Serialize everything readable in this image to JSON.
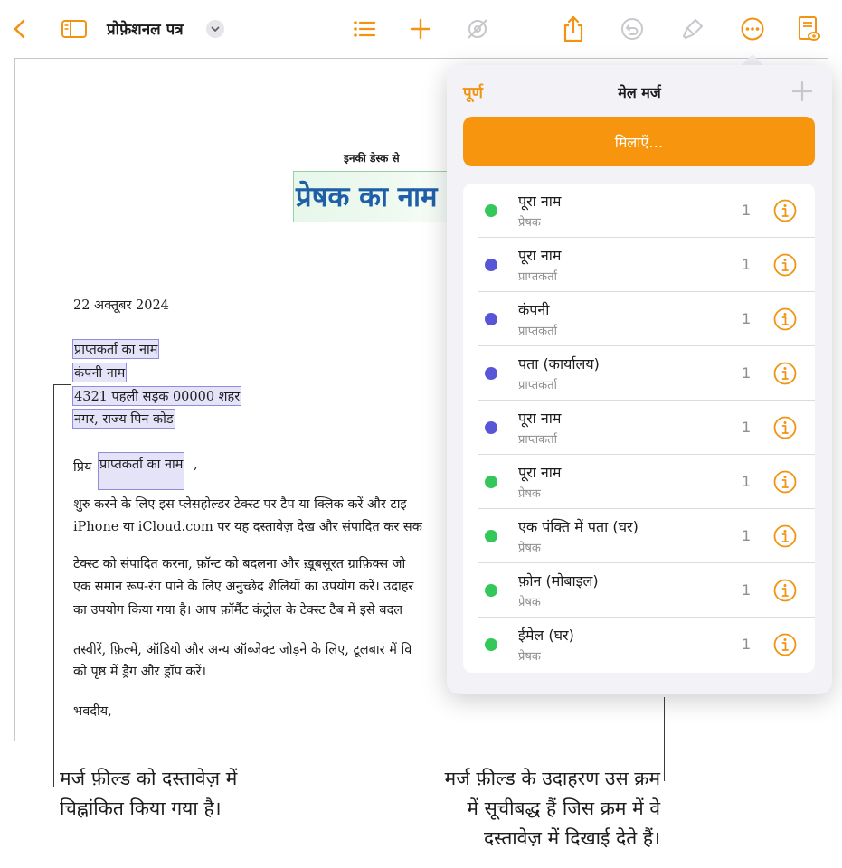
{
  "toolbar": {
    "document_title": "प्रोफ़ेशनल पत्र",
    "icons": [
      "back-chevron-icon",
      "sidebar-icon",
      "title-dropdown-icon",
      "list-icon",
      "add-icon",
      "collaborate-icon",
      "share-icon",
      "undo-icon",
      "format-brush-icon",
      "more-icon",
      "reading-view-icon"
    ],
    "accent": "#f29311"
  },
  "document": {
    "header_small": "इनकी डेस्क से",
    "sender_name_field": "प्रेषक का नाम",
    "date": "22 अक्तूबर 2024",
    "address": {
      "recipient_name": "प्राप्तकर्ता का नाम",
      "company": "कंपनी नाम",
      "street": "4321 पहली सड़क 00000 शहर",
      "city_state": "नगर, राज्य पिन कोड"
    },
    "salutation_prefix": "प्रिय",
    "salutation_field": "प्राप्तकर्ता का नाम",
    "salutation_suffix": ",",
    "paragraphs": [
      "शुरु करने के लिए इस प्लेसहोल्डर टेक्स्ट पर टैप या क्लिक करें और टाइ",
      "iPhone या iCloud.com पर यह दस्तावेज़ देख और संपादित कर सक",
      "टेक्स्ट को संपादित करना, फ़ॉन्ट को बदलना और ख़ूबसूरत ग्राफ़िक्स जो",
      "एक समान रूप-रंग पाने के लिए अनुच्छेद शैलियों का उपयोग करें। उदाहर",
      "का उपयोग किया गया है। आप फ़ॉर्मैट कंट्रोल के टेक्स्ट टैब में इसे बदल",
      "तस्वीरें, फ़िल्में, ऑडियो और अन्य ऑब्जेक्ट जोड़ने के लिए, टूलबार में वि",
      "को पृष्ठ में ड्रैग और ड्रॉप करें।"
    ],
    "closing": "भवदीय,",
    "field_colors": {
      "sender": "#9ad0a7",
      "recipient": "#8f8cdb"
    }
  },
  "popover": {
    "done_label": "पूर्ण",
    "title": "मेल मर्ज",
    "merge_button": "मिलाएँ…",
    "colors": {
      "sender": "#34c759",
      "recipient": "#5856d6",
      "button": "#f7950e"
    },
    "fields": [
      {
        "title": "पूरा नाम",
        "subtitle": "प्रेषक",
        "group": "sender",
        "count": "1"
      },
      {
        "title": "पूरा नाम",
        "subtitle": "प्राप्तकर्ता",
        "group": "recipient",
        "count": "1"
      },
      {
        "title": "कंपनी",
        "subtitle": "प्राप्तकर्ता",
        "group": "recipient",
        "count": "1"
      },
      {
        "title": "पता (कार्यालय)",
        "subtitle": "प्राप्तकर्ता",
        "group": "recipient",
        "count": "1"
      },
      {
        "title": "पूरा नाम",
        "subtitle": "प्राप्तकर्ता",
        "group": "recipient",
        "count": "1"
      },
      {
        "title": "पूरा नाम",
        "subtitle": "प्रेषक",
        "group": "sender",
        "count": "1"
      },
      {
        "title": "एक पंक्ति में पता (घर)",
        "subtitle": "प्रेषक",
        "group": "sender",
        "count": "1"
      },
      {
        "title": "फ़ोन (मोबाइल)",
        "subtitle": "प्रेषक",
        "group": "sender",
        "count": "1"
      },
      {
        "title": "ईमेल (घर)",
        "subtitle": "प्रेषक",
        "group": "sender",
        "count": "1"
      }
    ]
  },
  "callouts": {
    "left": [
      "मर्ज फ़ील्ड को दस्तावेज़ में",
      "चिह्नांकित किया गया है।"
    ],
    "right": [
      "मर्ज फ़ील्ड के उदाहरण उस क्रम",
      "में सूचीबद्ध हैं जिस क्रम में वे",
      "दस्तावेज़ में दिखाई देते हैं।"
    ]
  }
}
